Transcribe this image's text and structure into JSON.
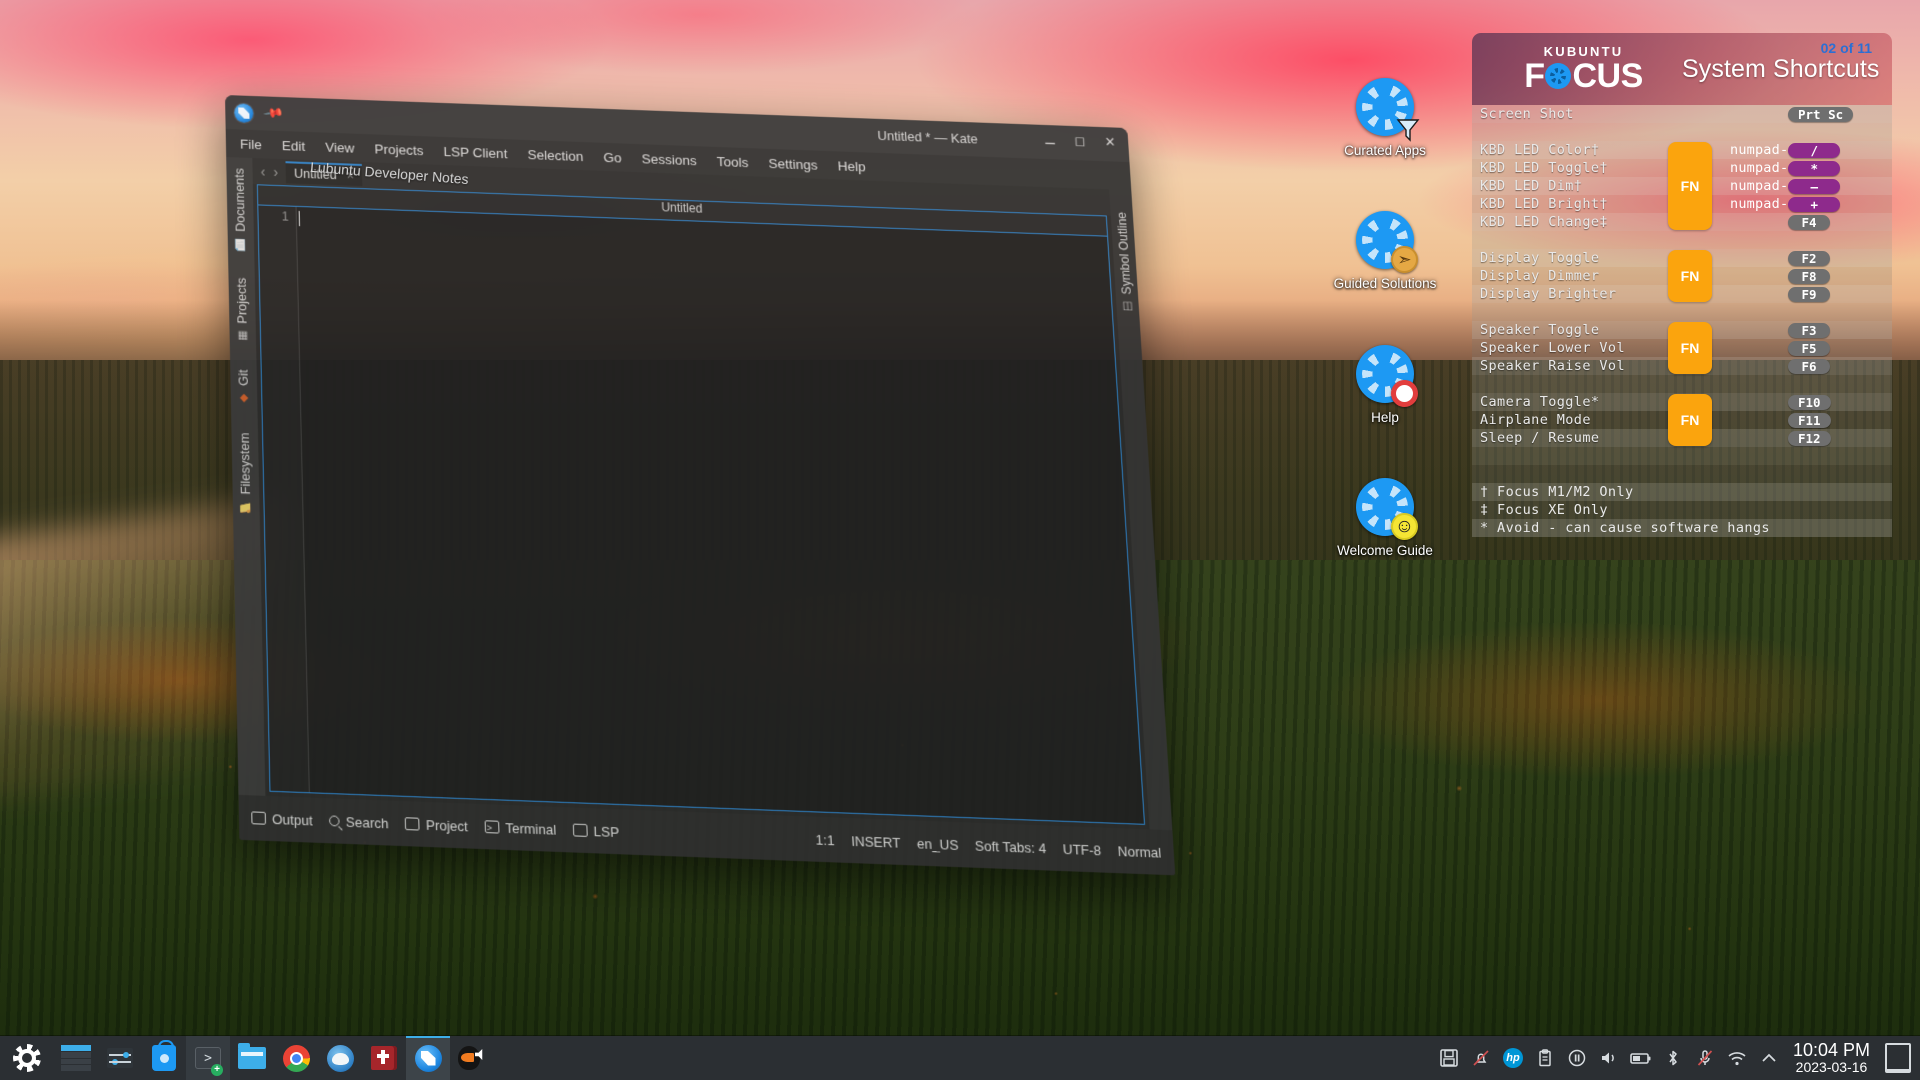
{
  "desktop": {
    "icons": [
      {
        "label": "Curated Apps",
        "icon": "kubuntu-focus-funnel-icon"
      },
      {
        "label": "Guided\nSolutions",
        "icon": "kubuntu-focus-compass-icon"
      },
      {
        "label": "Help",
        "icon": "kubuntu-focus-lifering-icon"
      },
      {
        "label": "Welcome\nGuide",
        "icon": "kubuntu-focus-smiley-icon"
      }
    ]
  },
  "hud": {
    "brand_top": "KUBUNTU",
    "brand_f": "F",
    "brand_cus": "CUS",
    "title": "System Shortcuts",
    "page": "02 of 11",
    "accent_orange": "#fba40d",
    "accent_purple": "#8e2a8c",
    "accent_blue": "#2b6fd4",
    "fn_label": "FN",
    "groups": [
      {
        "fn": false,
        "rows": [
          {
            "label": "Screen Shot",
            "prefix": "",
            "key": "Prt Sc",
            "keyclass": "wide"
          }
        ]
      },
      {
        "fn": true,
        "fn_rows": 5,
        "rows": [
          {
            "label": "KBD LED Color†",
            "prefix": "numpad-",
            "key": "/",
            "keyclass": "purple"
          },
          {
            "label": "KBD LED Toggle†",
            "prefix": "numpad-",
            "key": "*",
            "keyclass": "purple"
          },
          {
            "label": "KBD LED Dim†",
            "prefix": "numpad-",
            "key": "—",
            "keyclass": "purple"
          },
          {
            "label": "KBD LED Bright†",
            "prefix": "numpad-",
            "key": "+",
            "keyclass": "purple"
          },
          {
            "label": "KBD LED Change‡",
            "prefix": "",
            "key": "F4",
            "keyclass": ""
          }
        ]
      },
      {
        "fn": true,
        "fn_rows": 3,
        "rows": [
          {
            "label": "Display Toggle",
            "prefix": "",
            "key": "F2",
            "keyclass": ""
          },
          {
            "label": "Display Dimmer",
            "prefix": "",
            "key": "F8",
            "keyclass": ""
          },
          {
            "label": "Display Brighter",
            "prefix": "",
            "key": "F9",
            "keyclass": ""
          }
        ]
      },
      {
        "fn": true,
        "fn_rows": 3,
        "rows": [
          {
            "label": "Speaker Toggle",
            "prefix": "",
            "key": "F3",
            "keyclass": ""
          },
          {
            "label": "Speaker Lower Vol",
            "prefix": "",
            "key": "F5",
            "keyclass": ""
          },
          {
            "label": "Speaker Raise Vol",
            "prefix": "",
            "key": "F6",
            "keyclass": ""
          }
        ]
      },
      {
        "fn": true,
        "fn_rows": 3,
        "rows": [
          {
            "label": "Camera Toggle*",
            "prefix": "",
            "key": "F10",
            "keyclass": ""
          },
          {
            "label": "Airplane Mode",
            "prefix": "",
            "key": "F11",
            "keyclass": ""
          },
          {
            "label": "Sleep / Resume",
            "prefix": "",
            "key": "F12",
            "keyclass": ""
          }
        ]
      }
    ],
    "footnotes": [
      "† Focus M1/M2 Only",
      "‡ Focus XE Only",
      "* Avoid - can cause software hangs"
    ]
  },
  "kate": {
    "window_title": "Untitled * — Kate",
    "pin_icon": "pin-icon",
    "app_icon": "kate-app-icon",
    "menus": [
      "File",
      "Edit",
      "View",
      "Projects",
      "LSP Client",
      "Selection",
      "Go",
      "Sessions",
      "Tools",
      "Settings",
      "Help"
    ],
    "window_buttons": [
      "minimize",
      "maximize",
      "close"
    ],
    "side_tabs": [
      {
        "label": "Documents",
        "icon": "documents-icon"
      },
      {
        "label": "Projects",
        "icon": "projects-icon"
      },
      {
        "label": "Git",
        "icon": "git-icon"
      },
      {
        "label": "Filesystem",
        "icon": "filesystem-icon"
      }
    ],
    "nav_back": "‹",
    "nav_forward": "›",
    "doc_tab": "Untitled",
    "doc_tab_close": "×",
    "background_window_title": "Lubuntu Developer Notes",
    "inner_title": "Untitled",
    "line_number": "1",
    "right_tab": {
      "label": "Symbol Outline",
      "icon": "symbol-outline-icon"
    },
    "statusbar_left": [
      {
        "label": "Output",
        "icon": "output-icon"
      },
      {
        "label": "Search",
        "icon": "search-icon"
      },
      {
        "label": "Project",
        "icon": "project-icon"
      },
      {
        "label": "Terminal",
        "icon": "terminal-icon"
      },
      {
        "label": "LSP",
        "icon": "lsp-icon"
      }
    ],
    "statusbar_right": [
      "1:1",
      "INSERT",
      "en_US",
      "Soft Tabs: 4",
      "UTF-8",
      "Normal"
    ]
  },
  "taskbar": {
    "launchers": [
      {
        "name": "kickoff-application-launcher",
        "icon": "kubuntu-k-icon",
        "state": ""
      },
      {
        "name": "pager",
        "icon": "pager-icon",
        "state": ""
      },
      {
        "name": "system-settings",
        "icon": "sliders-icon",
        "state": ""
      },
      {
        "name": "discover-software-center",
        "icon": "software-store-icon",
        "state": ""
      },
      {
        "name": "konsole-terminal",
        "icon": "terminal-plus-icon",
        "state": "hover"
      },
      {
        "name": "file-manager",
        "icon": "folder-icon",
        "state": ""
      },
      {
        "name": "google-chrome",
        "icon": "chrome-icon",
        "state": ""
      },
      {
        "name": "thunderbird-mail",
        "icon": "thunderbird-icon",
        "state": ""
      },
      {
        "name": "bible-app",
        "icon": "bible-icon",
        "state": ""
      },
      {
        "name": "kate-editor",
        "icon": "kate-icon",
        "state": "active"
      },
      {
        "name": "audio-reader",
        "icon": "puffin-speaker-icon",
        "state": ""
      }
    ],
    "tray": [
      {
        "name": "save-session",
        "icon": "floppy-icon",
        "glyph": "὚B"
      },
      {
        "name": "notifications-muted",
        "icon": "bell-muted-icon",
        "glyph": "ὑ4"
      },
      {
        "name": "hp-support",
        "icon": "hp-logo-icon",
        "glyph": "hp"
      },
      {
        "name": "clipboard",
        "icon": "clipboard-icon",
        "glyph": "ὌB"
      },
      {
        "name": "media-player",
        "icon": "pause-circle-icon",
        "glyph": "⏸"
      },
      {
        "name": "volume",
        "icon": "speaker-icon",
        "glyph": "ὐA"
      },
      {
        "name": "battery",
        "icon": "battery-icon",
        "glyph": "ὐB"
      },
      {
        "name": "bluetooth",
        "icon": "bluetooth-icon",
        "glyph": "ʙ"
      },
      {
        "name": "microphone-muted",
        "icon": "mic-muted-icon",
        "glyph": "Ἲ4"
      },
      {
        "name": "network-wifi",
        "icon": "wifi-icon",
        "glyph": "὏6"
      },
      {
        "name": "show-hidden-tray",
        "icon": "chevron-up-icon",
        "glyph": "^"
      }
    ],
    "clock": {
      "time": "10:04 PM",
      "date": "2023-03-16"
    },
    "show_desktop": "show-desktop-button"
  }
}
